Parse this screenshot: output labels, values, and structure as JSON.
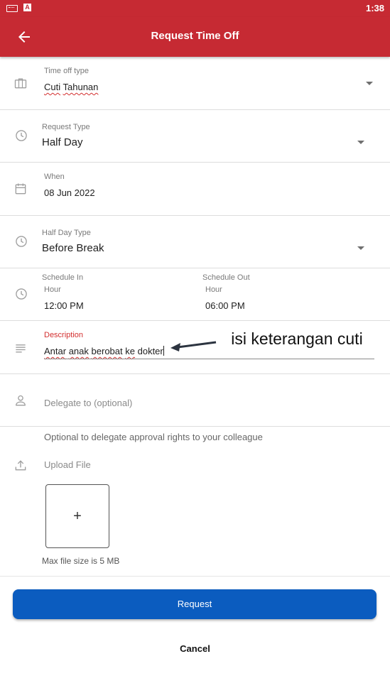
{
  "status_bar": {
    "time": "1:38",
    "notification_icon": "A"
  },
  "header": {
    "title": "Request Time Off",
    "back_icon": "arrow-left-icon"
  },
  "form": {
    "time_off_type": {
      "label": "Time off type",
      "value_word1": "Cuti",
      "value_word2": "Tahunan"
    },
    "request_type": {
      "label": "Request Type",
      "value": "Half Day"
    },
    "when": {
      "label": "When",
      "value": "08 Jun 2022"
    },
    "half_day_type": {
      "label": "Half Day Type",
      "value": "Before Break"
    },
    "schedule": {
      "in_label": "Schedule In",
      "in_sub": "Hour",
      "in_value": "12:00 PM",
      "out_label": "Schedule Out",
      "out_sub": "Hour",
      "out_value": "06:00 PM"
    },
    "description": {
      "label": "Description",
      "w1": "Antar",
      "w2": "anak",
      "w3": "berobat",
      "w4": "ke",
      "w5": "dokter",
      "label_color": "#d32f2f"
    },
    "annotation": "isi keterangan cuti",
    "delegate": {
      "placeholder": "Delegate to (optional)",
      "helper": "Optional to delegate approval rights to your colleague"
    },
    "upload": {
      "label": "Upload File",
      "plus": "+",
      "max_size": "Max file size is 5 MB"
    }
  },
  "actions": {
    "request": "Request",
    "cancel": "Cancel"
  },
  "colors": {
    "brand": "#c62a33",
    "primary_button": "#0b5cbf"
  }
}
